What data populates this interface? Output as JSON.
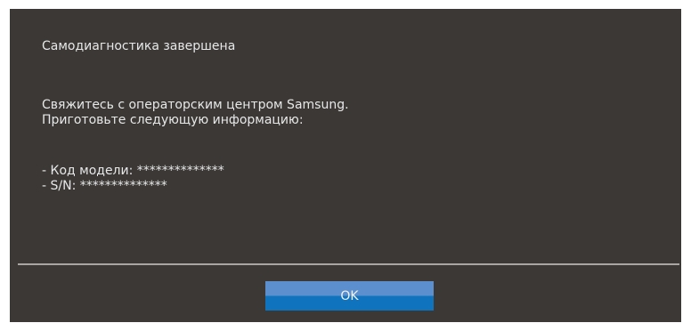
{
  "dialog": {
    "title": "Самодиагностика завершена",
    "message_lines": [
      "Свяжитесь с операторским центром Samsung.",
      "Приготовьте следующую информацию:"
    ],
    "info_lines": [
      "- Код модели: **************",
      "- S/N: **************"
    ],
    "ok_label": "OK"
  },
  "colors": {
    "background": "#3b3836",
    "text": "#e8e8e8",
    "divider": "#a9a6a3",
    "button_top": "#5b8fcd",
    "button_bottom": "#0f73bd"
  }
}
